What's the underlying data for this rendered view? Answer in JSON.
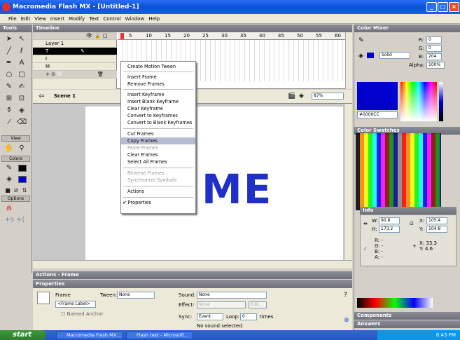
{
  "window": {
    "title": "Macromedia Flash MX - [Untitled-1]",
    "buttons": {
      "minimize": "_",
      "maximize": "□",
      "close": "×"
    }
  },
  "menubar": {
    "items": [
      "File",
      "Edit",
      "View",
      "Insert",
      "Modify",
      "Text",
      "Control",
      "Window",
      "Help"
    ]
  },
  "tools": {
    "header": "Tools",
    "view_label": "View",
    "colors_label": "Colors",
    "options_label": "Options"
  },
  "timeline": {
    "header": "Timeline",
    "layers": [
      "Layer 1",
      "T",
      "I",
      "M"
    ],
    "ruler": [
      "1",
      "5",
      "10",
      "15",
      "20",
      "25",
      "30",
      "35",
      "40",
      "45",
      "50",
      "55",
      "60",
      "65"
    ],
    "fps": "12.0 fps",
    "time": "0.0s"
  },
  "stage": {
    "scene": "Scene 1",
    "zoom": "87%",
    "text": "ME"
  },
  "context_menu": {
    "items": [
      {
        "label": "Create Motion Tween",
        "enabled": true
      },
      {
        "label": "Insert Frame",
        "enabled": true
      },
      {
        "label": "Remove Frames",
        "enabled": true
      },
      {
        "label": "Insert Keyframe",
        "enabled": true
      },
      {
        "label": "Insert Blank Keyframe",
        "enabled": true
      },
      {
        "label": "Clear Keyframe",
        "enabled": true
      },
      {
        "label": "Convert to Keyframes",
        "enabled": true
      },
      {
        "label": "Convert to Blank Keyframes",
        "enabled": true
      },
      {
        "label": "Cut Frames",
        "enabled": true
      },
      {
        "label": "Copy Frames",
        "enabled": true,
        "highlighted": true
      },
      {
        "label": "Paste Frames",
        "enabled": false
      },
      {
        "label": "Clear Frames",
        "enabled": true
      },
      {
        "label": "Select All Frames",
        "enabled": true
      },
      {
        "label": "Reverse Frames",
        "enabled": false
      },
      {
        "label": "Synchronize Symbols",
        "enabled": false
      },
      {
        "label": "Actions",
        "enabled": true
      },
      {
        "label": "✔ Properties",
        "enabled": true
      }
    ]
  },
  "actions_panel": {
    "header": "Actions - Frame"
  },
  "properties": {
    "header": "Properties",
    "frame_label": "Frame",
    "frame_placeholder": "<Frame Label>",
    "named_anchor": "Named Anchor",
    "tween_label": "Tween:",
    "tween_value": "None",
    "sound_label": "Sound:",
    "sound_value": "None",
    "effect_label": "Effect:",
    "effect_value": "None",
    "edit_button": "Edit...",
    "sync_label": "Sync:",
    "sync_value": "Event",
    "loop_label": "Loop:",
    "loop_value": "0",
    "times_label": "times",
    "status": "No sound selected."
  },
  "color_mixer": {
    "header": "Color Mixer",
    "type": "Solid",
    "r": "0",
    "g": "0",
    "b": "204",
    "alpha_label": "Alpha:",
    "alpha": "100%",
    "hex": "#0000CC",
    "r_label": "R:",
    "g_label": "G:",
    "b_label": "B:"
  },
  "color_swatches": {
    "header": "Color Swatches"
  },
  "info": {
    "header": "Info",
    "w_label": "W:",
    "w": "90.8",
    "h_label": "H:",
    "h": "173.2",
    "x_label": "X:",
    "x": "105.4",
    "y_label": "Y:",
    "y": "104.8",
    "r_label": "R:",
    "r": "-",
    "g_label": "G:",
    "g": "-",
    "b_label": "B:",
    "b": "-",
    "a_label": "A:",
    "a": "-",
    "mx_label": "X:",
    "mx": "33.3",
    "my_label": "Y:",
    "my": "4.6"
  },
  "components": {
    "header": "Components"
  },
  "answers": {
    "header": "Answers"
  },
  "taskbar": {
    "start": "start",
    "items": [
      "Macromedia Flash MX...",
      "Flash text - Microsoft..."
    ],
    "clock": "8:43 PM"
  },
  "colors": {
    "accent_blue": "#0000CC",
    "text_blue": "#1f2fc8",
    "titlebar": "#0a4fd8",
    "taskbar": "#2456c4"
  }
}
